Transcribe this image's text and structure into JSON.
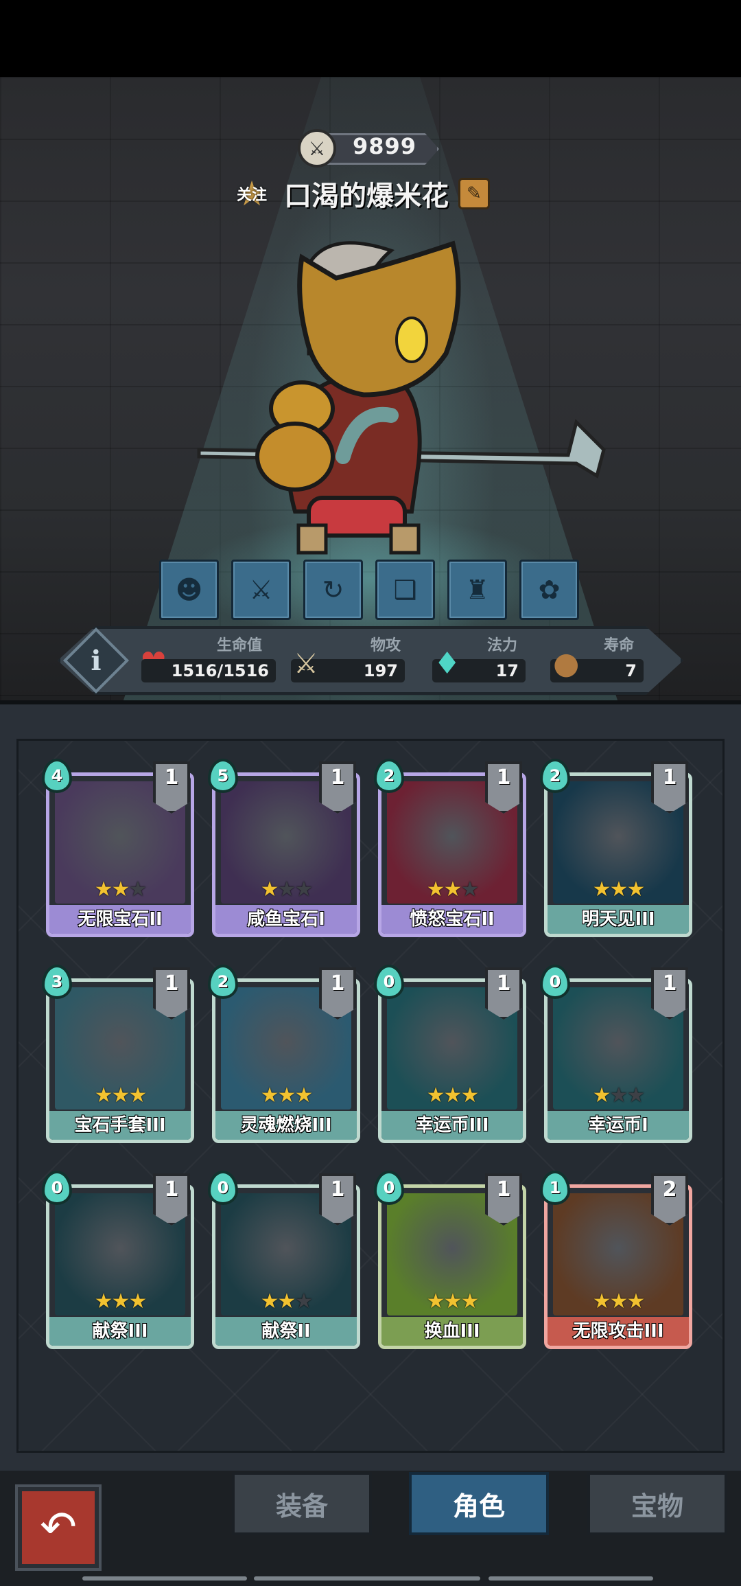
{
  "header": {
    "power": "9899",
    "follow_label": "关注",
    "player_name": "口渴的爆米花"
  },
  "skills": [
    {
      "icon": "demon-icon"
    },
    {
      "icon": "sword-icon"
    },
    {
      "icon": "swirl-icon"
    },
    {
      "icon": "book-icon"
    },
    {
      "icon": "figure-icon"
    },
    {
      "icon": "vine-icon"
    }
  ],
  "stats": {
    "hp_label": "生命值",
    "hp_value": "1516/1516",
    "atk_label": "物攻",
    "atk_value": "197",
    "mana_label": "法力",
    "mana_value": "17",
    "life_label": "寿命",
    "life_value": "7"
  },
  "cards": [
    {
      "name": "无限宝石II",
      "cost": "4",
      "count": "1",
      "stars": 2,
      "frame": "#b7a6e6",
      "band": "#9c8bd4",
      "art": "#4a3a5c"
    },
    {
      "name": "咸鱼宝石I",
      "cost": "5",
      "count": "1",
      "stars": 1,
      "frame": "#b7a6e6",
      "band": "#9c8bd4",
      "art": "#3f2f52"
    },
    {
      "name": "愤怒宝石II",
      "cost": "2",
      "count": "1",
      "stars": 2,
      "frame": "#b7a6e6",
      "band": "#9c8bd4",
      "art": "#6d2133"
    },
    {
      "name": "明天见III",
      "cost": "2",
      "count": "1",
      "stars": 3,
      "frame": "#bfd9cf",
      "band": "#6aa6a0",
      "art": "#17384a"
    },
    {
      "name": "宝石手套III",
      "cost": "3",
      "count": "1",
      "stars": 3,
      "frame": "#bfd9cf",
      "band": "#6aa6a0",
      "art": "#2f5864"
    },
    {
      "name": "灵魂燃烧III",
      "cost": "2",
      "count": "1",
      "stars": 3,
      "frame": "#bfd9cf",
      "band": "#6aa6a0",
      "art": "#2b5a70"
    },
    {
      "name": "幸运币III",
      "cost": "0",
      "count": "1",
      "stars": 3,
      "frame": "#bfd9cf",
      "band": "#6aa6a0",
      "art": "#1c4f56"
    },
    {
      "name": "幸运币I",
      "cost": "0",
      "count": "1",
      "stars": 1,
      "frame": "#bfd9cf",
      "band": "#6aa6a0",
      "art": "#1c4f56"
    },
    {
      "name": "献祭III",
      "cost": "0",
      "count": "1",
      "stars": 3,
      "frame": "#bfd9cf",
      "band": "#6aa6a0",
      "art": "#1c3c44"
    },
    {
      "name": "献祭II",
      "cost": "0",
      "count": "1",
      "stars": 2,
      "frame": "#bfd9cf",
      "band": "#6aa6a0",
      "art": "#1c3c44"
    },
    {
      "name": "换血III",
      "cost": "0",
      "count": "1",
      "stars": 3,
      "frame": "#c3d4a8",
      "band": "#7c9e52",
      "art": "#5a7f2a"
    },
    {
      "name": "无限攻击III",
      "cost": "1",
      "count": "2",
      "stars": 3,
      "frame": "#f0a6a0",
      "band": "#c65a4e",
      "art": "#5e3b24"
    }
  ],
  "nav": {
    "tab_equipment": "装备",
    "tab_character": "角色",
    "tab_treasure": "宝物",
    "active": "角色"
  },
  "colors": {
    "accent_active_tab": "#2f5f82",
    "back_button": "#a8382e",
    "star_on": "#f2c230"
  }
}
